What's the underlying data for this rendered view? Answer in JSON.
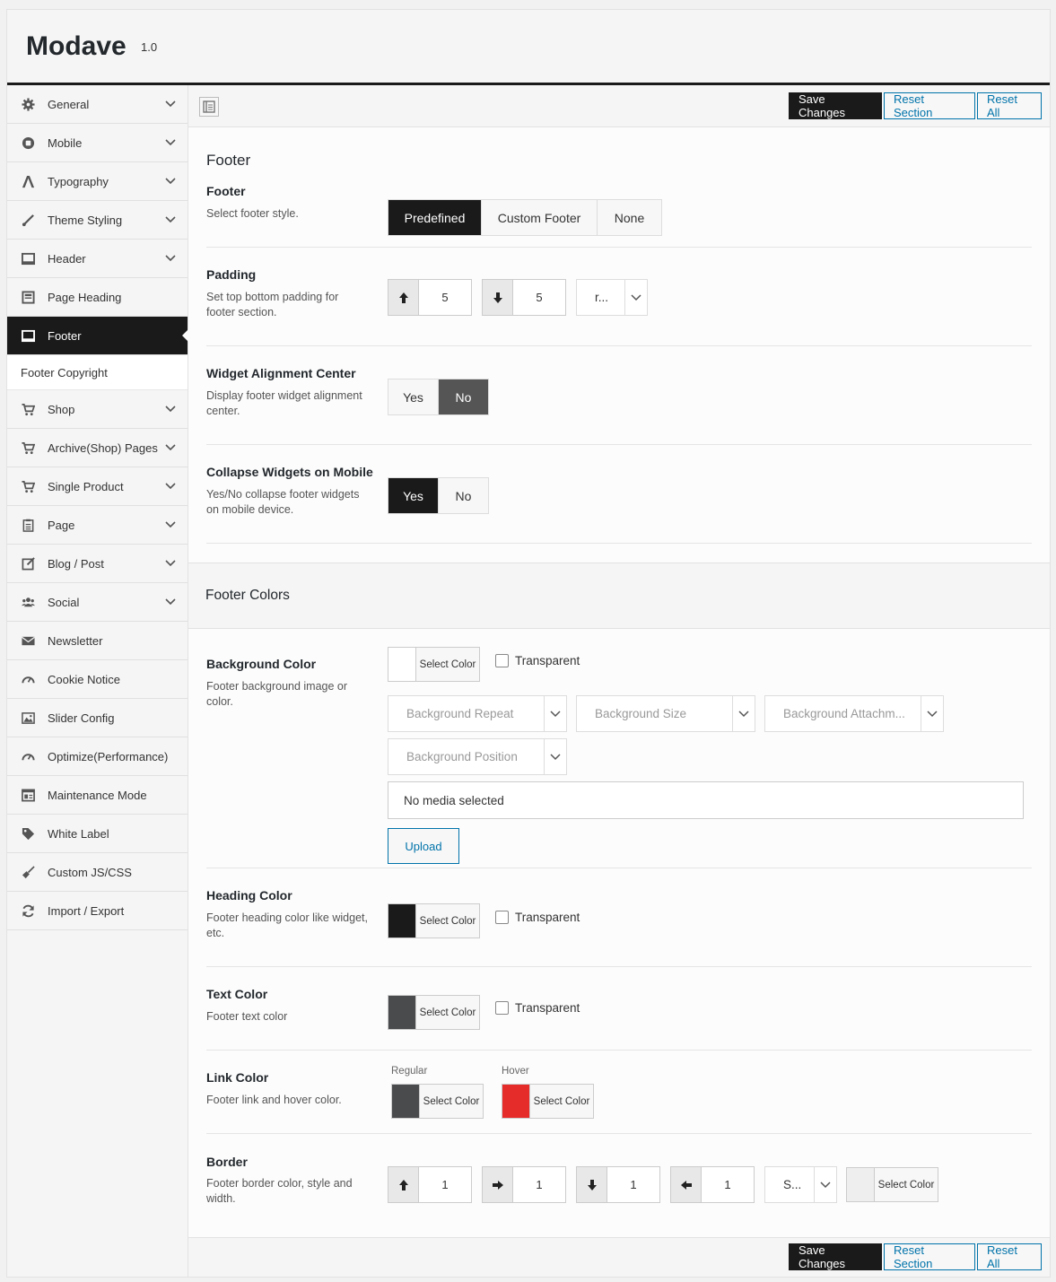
{
  "app": {
    "title": "Modave",
    "version": "1.0"
  },
  "sidebar": {
    "items": [
      {
        "label": "General",
        "icon": "gear-icon"
      },
      {
        "label": "Mobile",
        "icon": "mobile-icon"
      },
      {
        "label": "Typography",
        "icon": "font-icon"
      },
      {
        "label": "Theme Styling",
        "icon": "brush-icon"
      },
      {
        "label": "Header",
        "icon": "window-icon"
      },
      {
        "label": "Page Heading",
        "icon": "page-icon"
      },
      {
        "label": "Footer",
        "icon": "window-icon"
      },
      {
        "label": "Footer Copyright",
        "icon": ""
      },
      {
        "label": "Shop",
        "icon": "cart-icon"
      },
      {
        "label": "Archive(Shop) Pages",
        "icon": "cart-icon"
      },
      {
        "label": "Single Product",
        "icon": "cart-icon"
      },
      {
        "label": "Page",
        "icon": "clipboard-icon"
      },
      {
        "label": "Blog / Post",
        "icon": "edit-icon"
      },
      {
        "label": "Social",
        "icon": "users-icon"
      },
      {
        "label": "Newsletter",
        "icon": "envelope-icon"
      },
      {
        "label": "Cookie Notice",
        "icon": "dashboard-icon"
      },
      {
        "label": "Slider Config",
        "icon": "image-icon"
      },
      {
        "label": "Optimize(Performance)",
        "icon": "dashboard-icon"
      },
      {
        "label": "Maintenance Mode",
        "icon": "screen-icon"
      },
      {
        "label": "White Label",
        "icon": "tag-icon"
      },
      {
        "label": "Custom JS/CSS",
        "icon": "broom-icon"
      },
      {
        "label": "Import / Export",
        "icon": "refresh-icon"
      }
    ]
  },
  "toolbar": {
    "save": "Save Changes",
    "reset_section": "Reset Section",
    "reset_all": "Reset All"
  },
  "footer_section": {
    "title": "Footer",
    "footer": {
      "title": "Footer",
      "desc": "Select footer style.",
      "options": [
        "Predefined",
        "Custom Footer",
        "None"
      ],
      "selected": "Predefined"
    },
    "padding": {
      "title": "Padding",
      "desc": "Set top bottom padding for footer section.",
      "top": "5",
      "bottom": "5",
      "unit": "r..."
    },
    "widget_alignment": {
      "title": "Widget Alignment Center",
      "desc": "Display footer widget alignment center.",
      "yes": "Yes",
      "no": "No",
      "selected": "No"
    },
    "collapse_widgets": {
      "title": "Collapse Widgets on Mobile",
      "desc": "Yes/No collapse footer widgets on mobile device.",
      "yes": "Yes",
      "no": "No",
      "selected": "Yes"
    }
  },
  "colors_section": {
    "title": "Footer Colors",
    "select_color": "Select Color",
    "transparent": "Transparent",
    "background": {
      "title": "Background Color",
      "desc": "Footer background image or color.",
      "swatch": "#ffffff",
      "repeat_placeholder": "Background Repeat",
      "size_placeholder": "Background Size",
      "attachment_placeholder": "Background Attachm...",
      "position_placeholder": "Background Position",
      "media": "No media selected",
      "upload": "Upload"
    },
    "heading": {
      "title": "Heading Color",
      "desc": "Footer heading color like widget, etc.",
      "swatch": "#1a1a1a"
    },
    "text": {
      "title": "Text Color",
      "desc": "Footer text color",
      "swatch": "#4a4b4d"
    },
    "link": {
      "title": "Link Color",
      "desc": "Footer link and hover color.",
      "regular_label": "Regular",
      "hover_label": "Hover",
      "regular_swatch": "#4a4b4d",
      "hover_swatch": "#e62b2b"
    },
    "border": {
      "title": "Border",
      "desc": "Footer border color, style and width.",
      "top": "1",
      "right": "1",
      "bottom": "1",
      "left": "1",
      "style": "S...",
      "swatch": "#eeeeee"
    }
  }
}
